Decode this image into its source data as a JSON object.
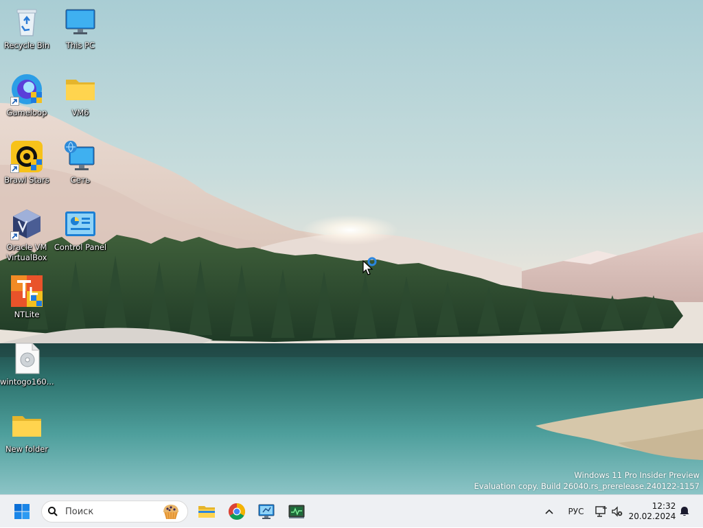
{
  "desktop": {
    "icons": [
      {
        "label": "Recycle Bin",
        "icon": "recycle-bin-icon"
      },
      {
        "label": "This PC",
        "icon": "this-pc-icon"
      },
      {
        "label": "Gameloop",
        "icon": "gameloop-icon"
      },
      {
        "label": "VM6",
        "icon": "folder-icon"
      },
      {
        "label": "Brawl Stars",
        "icon": "brawl-stars-icon"
      },
      {
        "label": "Сеть",
        "icon": "network-icon"
      },
      {
        "label": "Oracle VM VirtualBox",
        "icon": "virtualbox-icon"
      },
      {
        "label": "Control Panel",
        "icon": "control-panel-icon"
      },
      {
        "label": "NTLite",
        "icon": "ntlite-icon"
      },
      {
        "label": "wintogo160...",
        "icon": "disc-image-file-icon"
      },
      {
        "label": "New folder",
        "icon": "folder-icon"
      }
    ],
    "watermark": {
      "line1": "Windows 11 Pro Insider Preview",
      "line2": "Evaluation copy. Build 26040.rs_prerelease.240122-1157"
    }
  },
  "taskbar": {
    "search": {
      "placeholder": "Поиск"
    },
    "pinned_apps": [
      {
        "name": "File Explorer",
        "icon": "file-explorer-icon"
      },
      {
        "name": "Google Chrome",
        "icon": "chrome-icon"
      },
      {
        "name": "Control Panel",
        "icon": "control-panel-icon"
      },
      {
        "name": "Task Manager",
        "icon": "task-manager-icon"
      }
    ],
    "tray": {
      "language": "РУС",
      "time": "12:32",
      "date": "20.02.2024"
    }
  },
  "colors": {
    "taskbar_bg": "#eef0f3",
    "start_blue": "#0a6fd6",
    "text_white": "#ffffff"
  }
}
